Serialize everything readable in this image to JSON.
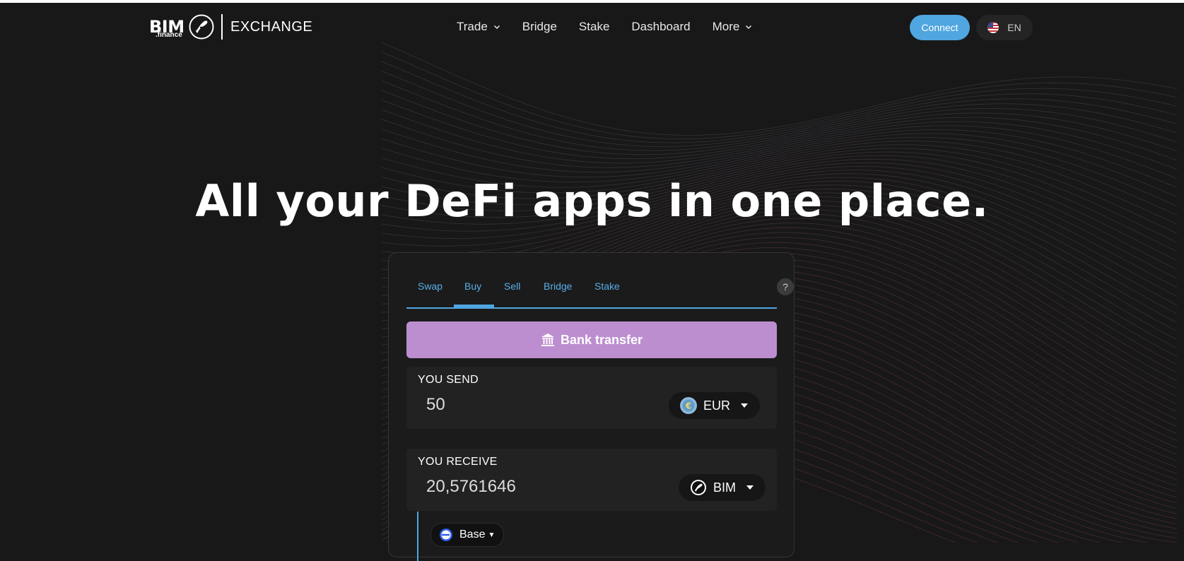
{
  "header": {
    "logo": {
      "brand": "BIM",
      "sub": ".finance",
      "product": "EXCHANGE"
    },
    "nav": [
      {
        "label": "Trade",
        "has_dropdown": true
      },
      {
        "label": "Bridge",
        "has_dropdown": false
      },
      {
        "label": "Stake",
        "has_dropdown": false
      },
      {
        "label": "Dashboard",
        "has_dropdown": false
      },
      {
        "label": "More",
        "has_dropdown": true
      }
    ],
    "connect_label": "Connect",
    "language": {
      "label": "EN",
      "flag_icon": "us-flag-icon"
    }
  },
  "hero": {
    "title": "All your DeFi apps in one place."
  },
  "widget": {
    "tabs": [
      {
        "label": "Swap"
      },
      {
        "label": "Buy",
        "active": true
      },
      {
        "label": "Sell"
      },
      {
        "label": "Bridge"
      },
      {
        "label": "Stake"
      }
    ],
    "help_label": "?",
    "payment_method": {
      "label": "Bank transfer",
      "icon": "bank-icon"
    },
    "send": {
      "label": "YOU SEND",
      "amount": "50",
      "currency": "EUR",
      "currency_icon": "euro-coin-icon"
    },
    "receive": {
      "label": "YOU RECEIVE",
      "amount": "20,5761646",
      "currency": "BIM",
      "currency_icon": "bim-token-icon"
    },
    "network": {
      "label": "Base",
      "icon": "base-network-icon"
    }
  },
  "colors": {
    "background": "#181818",
    "accent_blue": "#4fa6e0",
    "bank_button": "#bc8ecf",
    "panel": "#222222"
  }
}
